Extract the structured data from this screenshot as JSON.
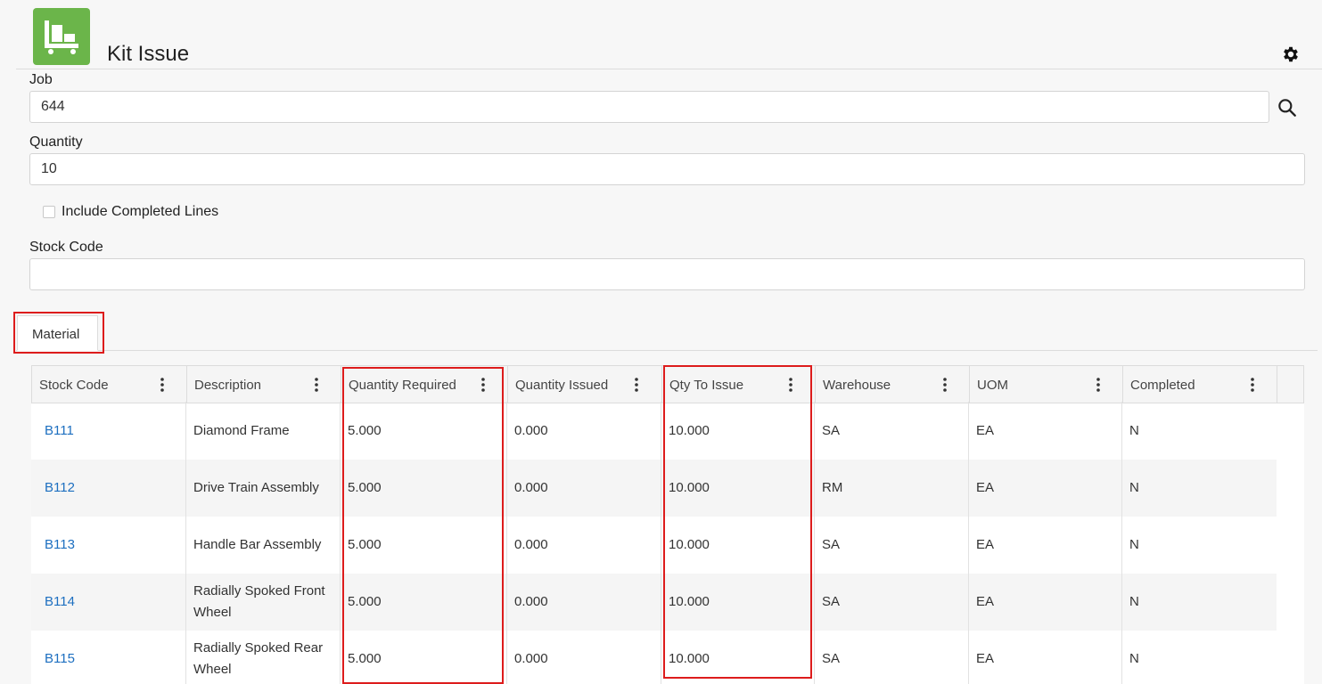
{
  "app": {
    "title": "Kit Issue"
  },
  "form": {
    "job_label": "Job",
    "job_value": "644",
    "quantity_label": "Quantity",
    "quantity_value": "10",
    "include_completed_label": "Include Completed Lines",
    "include_completed_checked": false,
    "stock_code_label": "Stock Code",
    "stock_code_value": ""
  },
  "tabs": [
    {
      "label": "Material",
      "active": true
    }
  ],
  "grid": {
    "columns": [
      "Stock Code",
      "Description",
      "Quantity Required",
      "Quantity Issued",
      "Qty To Issue",
      "Warehouse",
      "UOM",
      "Completed"
    ],
    "rows": [
      {
        "stock_code": "B111",
        "description": "Diamond Frame",
        "qty_required": "5.000",
        "qty_issued": "0.000",
        "qty_to_issue": "10.000",
        "warehouse": "SA",
        "uom": "EA",
        "completed": "N"
      },
      {
        "stock_code": "B112",
        "description": "Drive Train Assembly",
        "qty_required": "5.000",
        "qty_issued": "0.000",
        "qty_to_issue": "10.000",
        "warehouse": "RM",
        "uom": "EA",
        "completed": "N"
      },
      {
        "stock_code": "B113",
        "description": "Handle Bar Assembly",
        "qty_required": "5.000",
        "qty_issued": "0.000",
        "qty_to_issue": "10.000",
        "warehouse": "SA",
        "uom": "EA",
        "completed": "N"
      },
      {
        "stock_code": "B114",
        "description": "Radially Spoked Front Wheel",
        "qty_required": "5.000",
        "qty_issued": "0.000",
        "qty_to_issue": "10.000",
        "warehouse": "SA",
        "uom": "EA",
        "completed": "N"
      },
      {
        "stock_code": "B115",
        "description": "Radially Spoked Rear Wheel",
        "qty_required": "5.000",
        "qty_issued": "0.000",
        "qty_to_issue": "10.000",
        "warehouse": "SA",
        "uom": "EA",
        "completed": "N"
      }
    ]
  },
  "colors": {
    "brand": "#6bb54a",
    "link": "#1d6fc0",
    "highlight": "#dd1c1c"
  }
}
